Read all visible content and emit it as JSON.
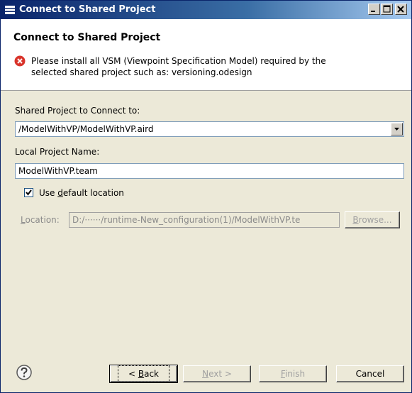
{
  "window": {
    "title": "Connect to Shared Project"
  },
  "header": {
    "title": "Connect to Shared Project",
    "message_line1": "Please install all VSM (Viewpoint Specification Model) required by the",
    "message_line2": "selected shared project such as: versioning.odesign"
  },
  "form": {
    "shared_project_label": "Shared Project to Connect to:",
    "shared_project_value": "/ModelWithVP/ModelWithVP.aird",
    "local_project_label": "Local Project Name:",
    "local_project_value": "ModelWithVP.team",
    "use_default_checked": true,
    "use_default_prefix": "Use ",
    "use_default_mnemonic": "d",
    "use_default_suffix": "efault location",
    "location_mnemonic": "L",
    "location_label_rest": "ocation:",
    "location_value": "D:/······/runtime-New_configuration(1)/ModelWithVP.te",
    "browse_mnemonic": "B",
    "browse_rest": "rowse..."
  },
  "buttons": {
    "back_prefix": "< ",
    "back_mnemonic": "B",
    "back_rest": "ack",
    "next_mnemonic": "N",
    "next_rest": "ext >",
    "finish_mnemonic": "F",
    "finish_rest": "inish",
    "cancel": "Cancel"
  }
}
